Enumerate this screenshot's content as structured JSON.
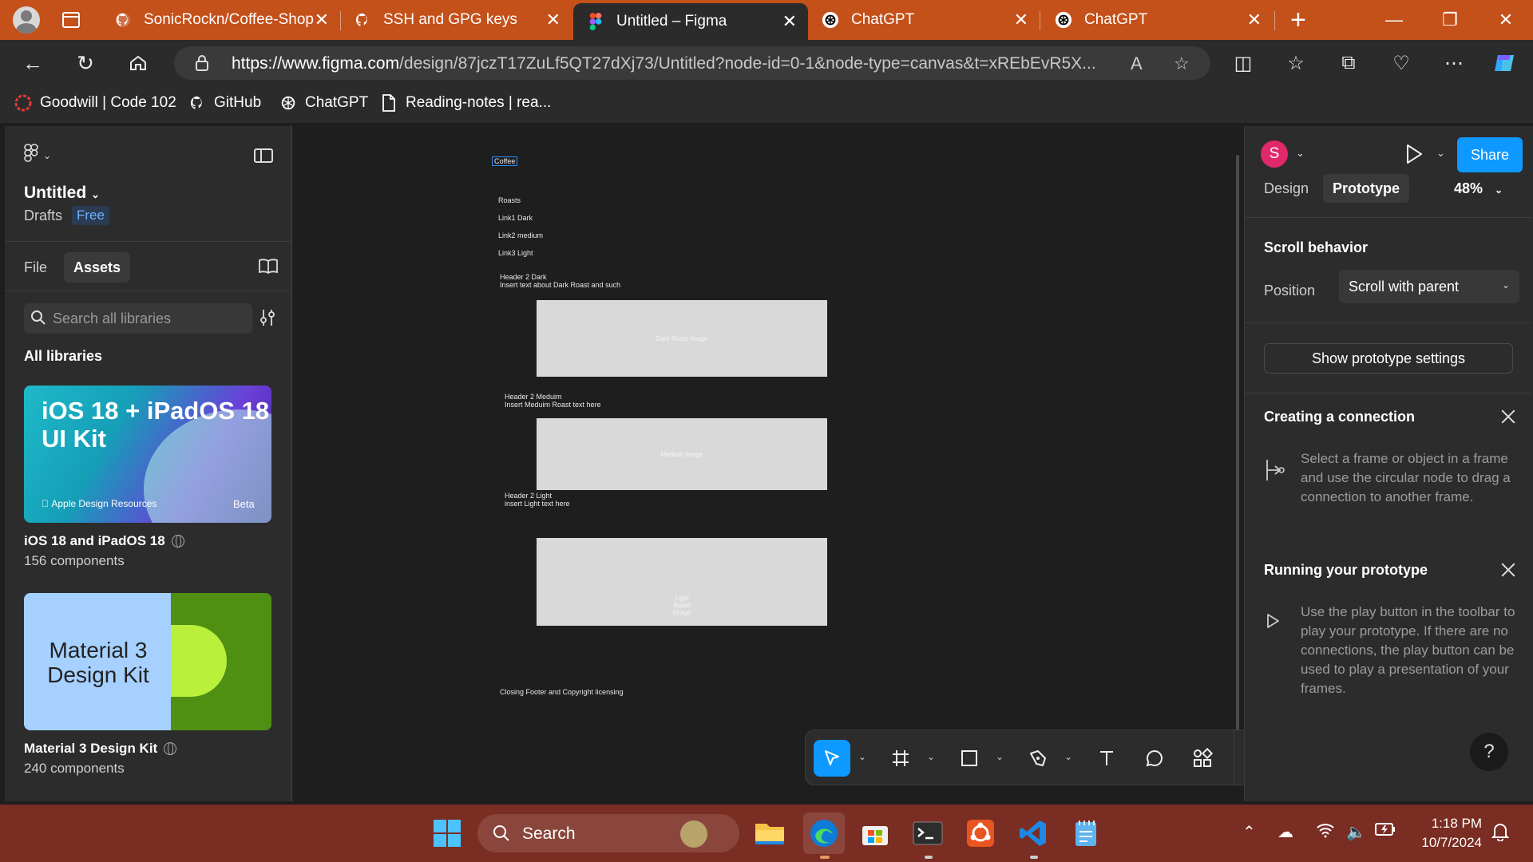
{
  "browser": {
    "tabs": [
      {
        "label": "SonicRockn/Coffee-Shop",
        "icon": "github-icon"
      },
      {
        "label": "SSH and GPG keys",
        "icon": "github-icon"
      },
      {
        "label": "Untitled – Figma",
        "icon": "figma-icon",
        "active": true
      },
      {
        "label": "ChatGPT",
        "icon": "chatgpt-icon"
      },
      {
        "label": "ChatGPT",
        "icon": "chatgpt-icon"
      }
    ],
    "url_domain": "https://www.figma.com",
    "url_path": "/design/87jczT17ZuLf5QT27dXj73/Untitled?node-id=0-1&node-type=canvas&t=xREbEvR5X...",
    "bookmarks": [
      "Goodwill | Code 102",
      "GitHub",
      "ChatGPT",
      "Reading-notes | rea..."
    ]
  },
  "figma": {
    "file_title": "Untitled",
    "drafts_label": "Drafts",
    "plan_badge": "Free",
    "left_tabs": [
      "File",
      "Assets"
    ],
    "search_placeholder": "Search all libraries",
    "all_libraries_label": "All libraries",
    "libraries": [
      {
        "card_title": "iOS 18 + iPadOS 18 UI Kit",
        "card_footer": "Apple Design Resources",
        "card_badge": "Beta",
        "name": "iOS 18 and iPadOS 18",
        "count": "156 components"
      },
      {
        "card_title": "Material 3 Design Kit",
        "name": "Material 3 Design Kit",
        "count": "240 components"
      }
    ],
    "canvas": {
      "title": "Coffee",
      "nav": [
        "Roasts",
        "Link1 Dark",
        "Link2 medium",
        "Link3 Light"
      ],
      "sections": [
        {
          "header": "Header 2 Dark",
          "text": "Insert text about Dark Roast and such",
          "image_label": "Dark Roast Image"
        },
        {
          "header": "Header 2 Meduim",
          "text": "Insert Meduim Roast text here",
          "image_label": "Medium Image"
        },
        {
          "header": "Header 2 Light",
          "text": "insert Light text here",
          "image_label": "Light Roast Image"
        }
      ],
      "footer": "Closing Footer and Copyright licensing"
    },
    "right": {
      "avatar_letter": "S",
      "share_label": "Share",
      "tabs": [
        "Design",
        "Prototype"
      ],
      "zoom": "48%",
      "scroll_behavior_heading": "Scroll behavior",
      "position_label": "Position",
      "position_value": "Scroll with parent",
      "proto_settings_button": "Show prototype settings",
      "creating_heading": "Creating a connection",
      "creating_text": "Select a frame or object in a frame and use the circular node to drag a connection to another frame.",
      "running_heading": "Running your prototype",
      "running_text": "Use the play button in the toolbar to play your prototype. If there are no connections, the play button can be used to play a presentation of your frames.",
      "help_label": "?"
    }
  },
  "taskbar": {
    "search_placeholder": "Search",
    "time": "1:18 PM",
    "date": "10/7/2024"
  },
  "colors": {
    "tab_bar": "#c4501a",
    "figma_blue": "#0d99ff",
    "taskbar": "#7a2d22"
  }
}
